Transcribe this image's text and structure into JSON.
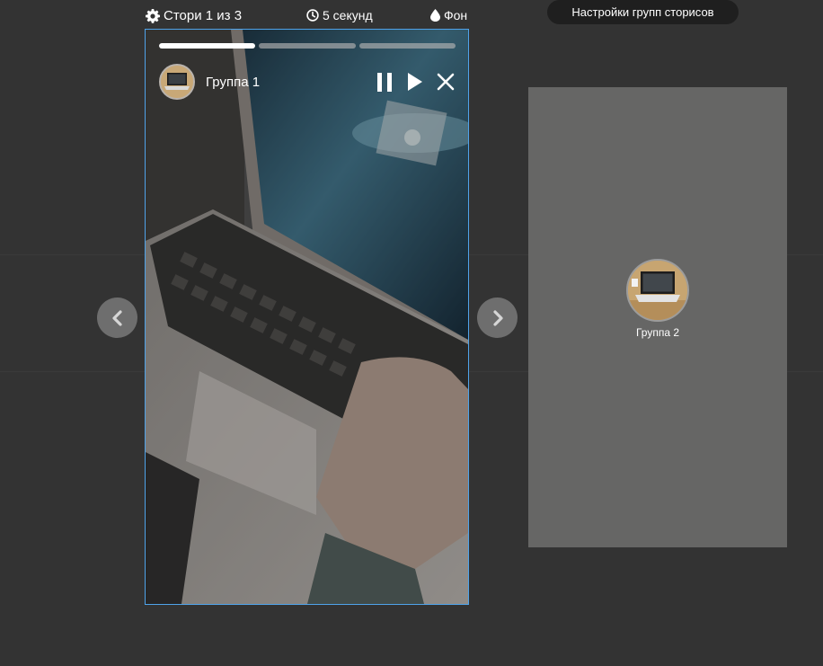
{
  "topbar": {
    "stories_counter": "Стори 1 из 3",
    "duration": "5 секунд",
    "background": "Фон",
    "settings_button": "Настройки групп сторисов"
  },
  "story": {
    "group_name": "Группа 1",
    "progress": [
      1.0,
      0.0,
      0.0
    ],
    "controls": {
      "pause_icon": "pause-icon",
      "play_icon": "play-icon",
      "close_icon": "close-icon"
    }
  },
  "navigation": {
    "prev_icon": "chevron-left-icon",
    "next_icon": "chevron-right-icon"
  },
  "next_group": {
    "name": "Группа 2"
  },
  "colors": {
    "page_bg": "#333333",
    "accent_border": "#4fa3ea",
    "settings_bg": "#1f1f1f",
    "card_bg": "#666665"
  }
}
